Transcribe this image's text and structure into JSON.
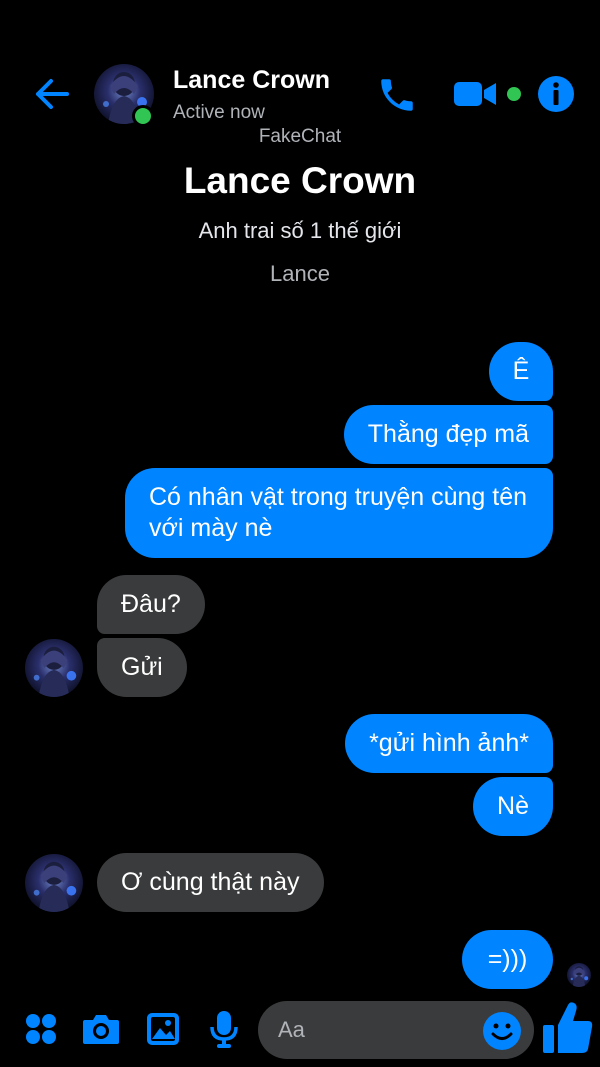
{
  "header": {
    "contact_name": "Lance Crown",
    "status": "Active now"
  },
  "watermark": "FakeChat",
  "intro": {
    "name": "Lance Crown",
    "bio": "Anh trai số 1 thế giới",
    "nickname": "Lance"
  },
  "messages": [
    {
      "direction": "outgoing",
      "text": "Ê"
    },
    {
      "direction": "outgoing",
      "text": "Thằng đẹp mã"
    },
    {
      "direction": "outgoing",
      "text": "Có nhân vật trong truyện cùng tên với mày nè"
    },
    {
      "direction": "incoming",
      "text": "Đâu?"
    },
    {
      "direction": "incoming",
      "text": "Gửi"
    },
    {
      "direction": "outgoing",
      "text": "*gửi hình ảnh*"
    },
    {
      "direction": "outgoing",
      "text": "Nè"
    },
    {
      "direction": "incoming",
      "text": "Ơ cùng thật này"
    },
    {
      "direction": "outgoing",
      "text": "=)))"
    }
  ],
  "composer": {
    "placeholder": "Aa"
  },
  "colors": {
    "accent": "#0084ff",
    "online": "#31c553",
    "incoming_bubble": "#3a3b3c",
    "background": "#000000"
  },
  "icons": {
    "back": "arrow-left-icon",
    "call": "phone-icon",
    "video": "video-camera-icon",
    "info": "info-icon",
    "apps": "four-dots-icon",
    "camera": "camera-icon",
    "gallery": "image-icon",
    "mic": "microphone-icon",
    "emoji": "smiley-icon",
    "like": "thumbs-up-icon"
  }
}
